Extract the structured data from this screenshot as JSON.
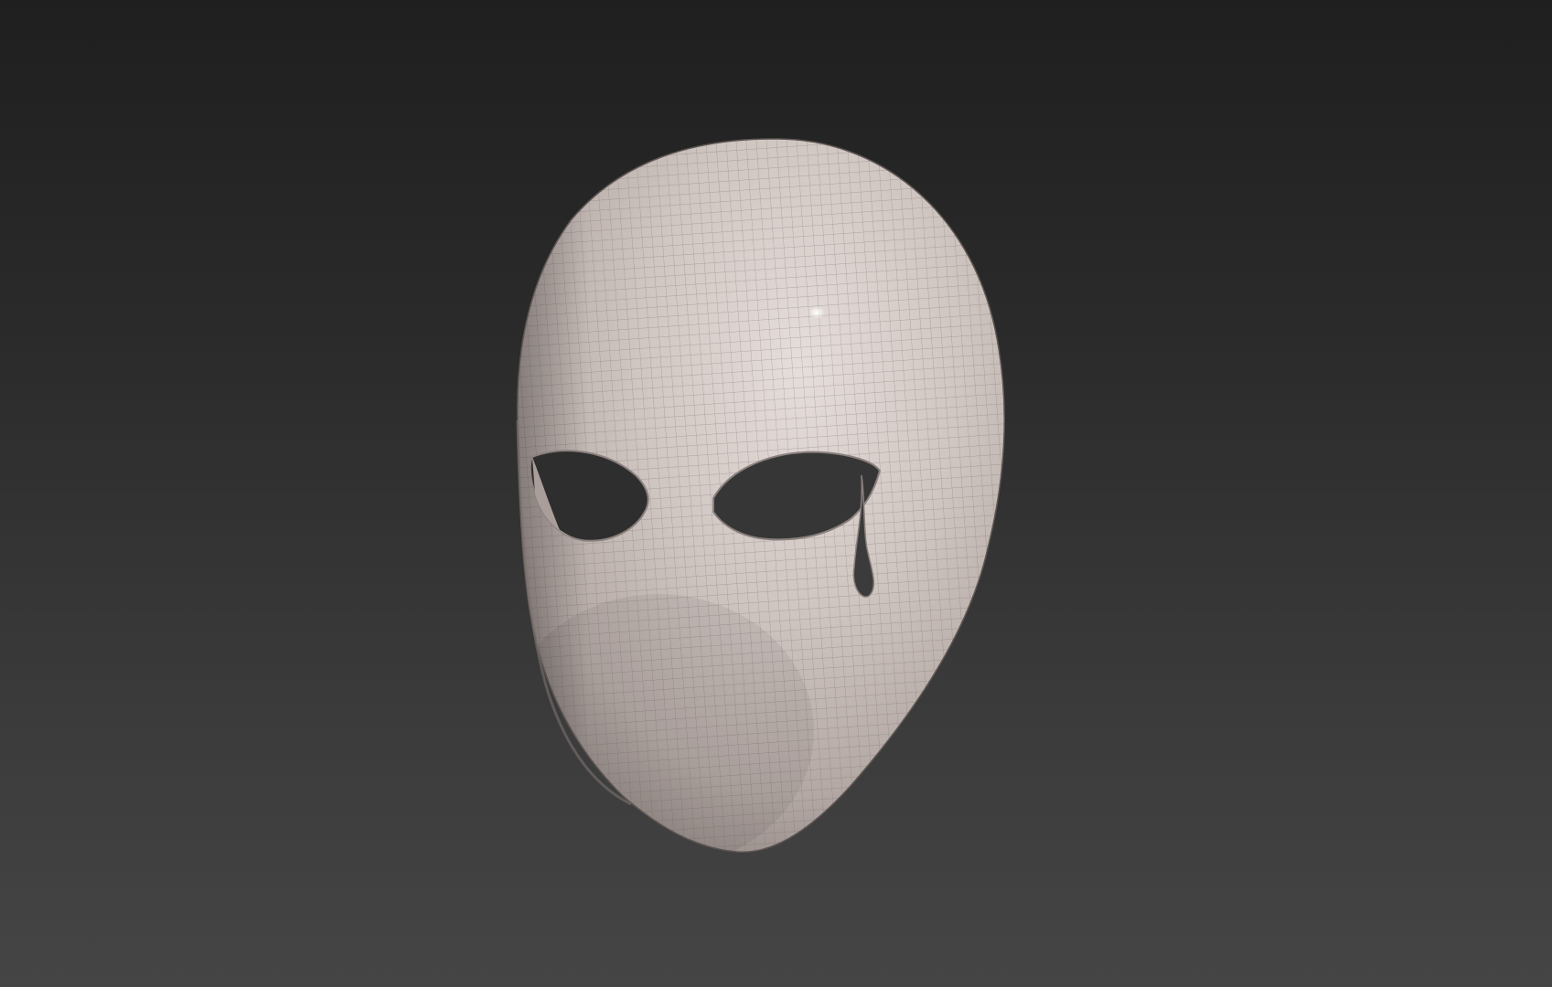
{
  "viewport": {
    "background_top": "#1f1f1f",
    "background_bottom": "#454545"
  },
  "model": {
    "object": "mask-mesh",
    "surface_color": "#c9bfbb",
    "wire_color": "#6e6663",
    "shading": "smooth-with-wireframe-overlay",
    "features": [
      "left-eye-hole",
      "right-eye-hole",
      "tear-drop-cutout"
    ]
  }
}
